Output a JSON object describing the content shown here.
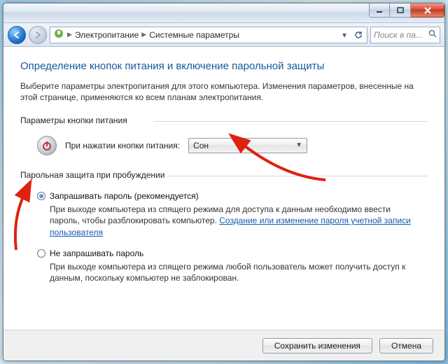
{
  "breadcrumb": {
    "root": "Электропитание",
    "current": "Системные параметры"
  },
  "search": {
    "placeholder": "Поиск в па..."
  },
  "page": {
    "title": "Определение кнопок питания и включение парольной защиты",
    "intro": "Выберите параметры электропитания для этого компьютера. Изменения параметров, внесенные на этой странице, применяются ко всем планам электропитания."
  },
  "group1": {
    "legend": "Параметры кнопки питания",
    "row_label": "При нажатии кнопки питания:",
    "dropdown_value": "Сон"
  },
  "group2": {
    "legend": "Парольная защита при пробуждении",
    "opt1_label": "Запрашивать пароль (рекомендуется)",
    "opt1_desc_a": "При выходе компьютера из спящего режима для доступа к данным необходимо ввести пароль, чтобы разблокировать компьютер. ",
    "opt1_link": "Создание или изменение пароля учетной записи пользователя",
    "opt2_label": "Не запрашивать пароль",
    "opt2_desc": "При выходе компьютера из спящего режима любой пользователь может получить доступ к данным, поскольку компьютер не заблокирован."
  },
  "buttons": {
    "save": "Сохранить изменения",
    "cancel": "Отмена"
  }
}
